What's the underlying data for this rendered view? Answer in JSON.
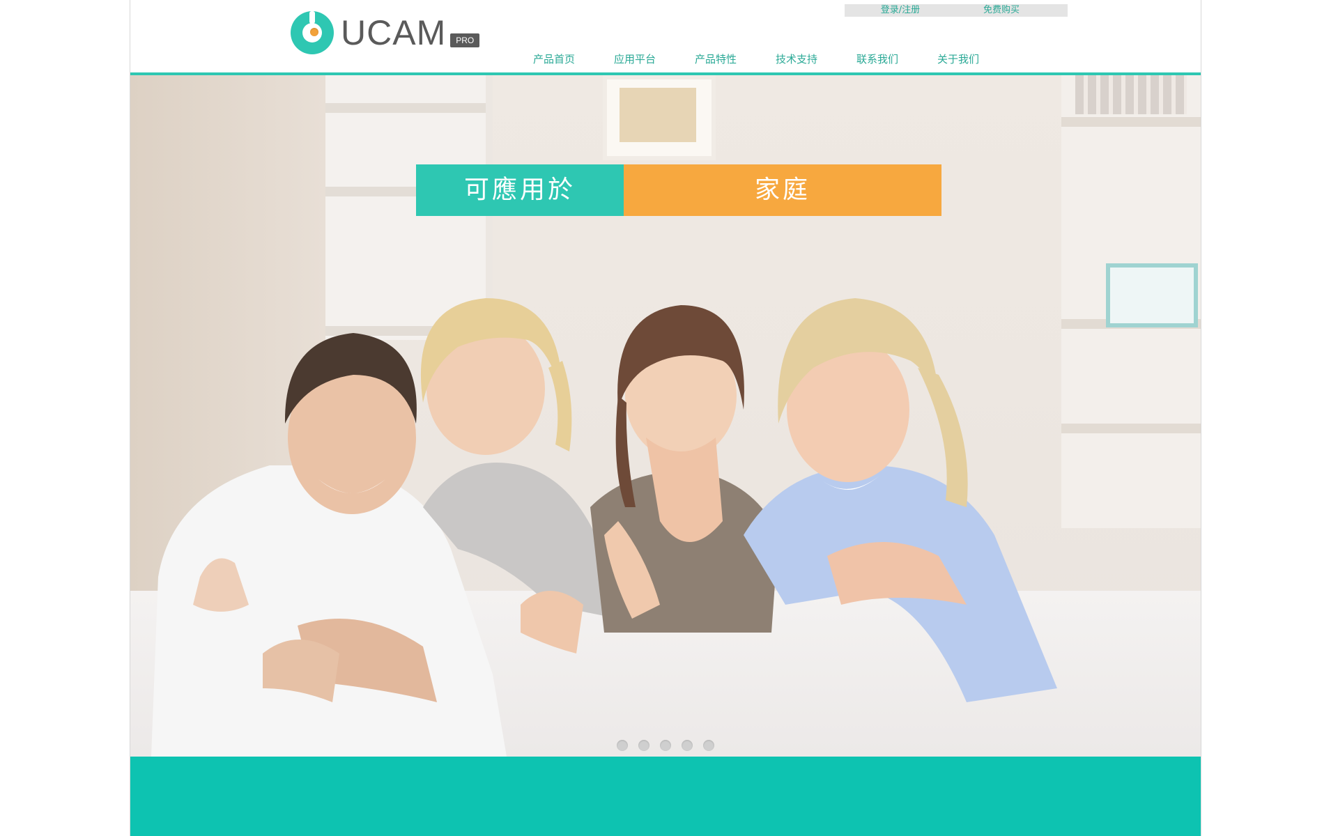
{
  "brand": {
    "name": "UCAM",
    "badge": "PRO",
    "accent": "#2ec7b2",
    "orange": "#f7a83f"
  },
  "top_links": [
    "登录/注册",
    "免费购买"
  ],
  "nav": {
    "items": [
      "产品首页",
      "应用平台",
      "产品特性",
      "技术支持",
      "联系我们",
      "关于我们"
    ]
  },
  "hero": {
    "caption_left": "可應用於",
    "caption_right": "家庭",
    "slide_count": 5
  }
}
